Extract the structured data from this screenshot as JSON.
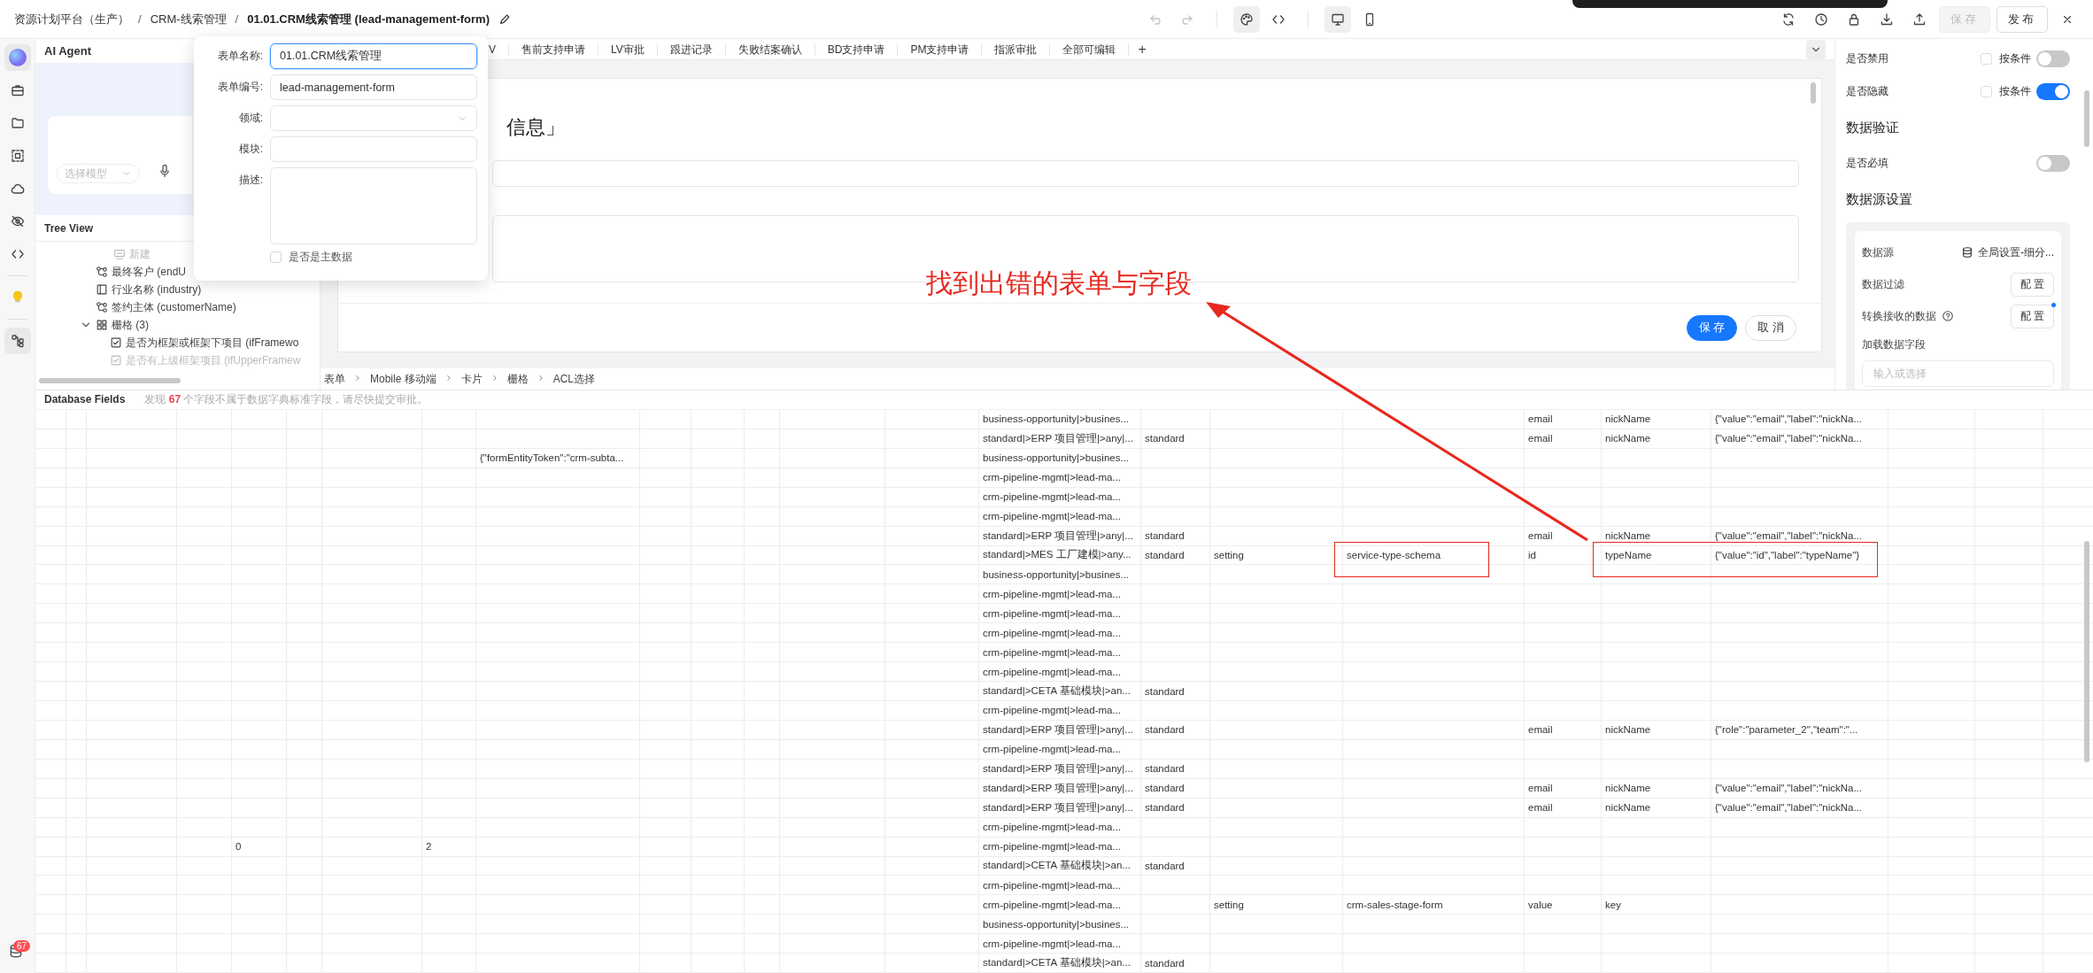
{
  "topbar": {
    "breadcrumb": [
      "资源计划平台（生产）",
      "CRM-线索管理",
      "01.01.CRM线索管理 (lead-management-form)"
    ],
    "separator": "/",
    "history_buttons": [
      {
        "kind": "undo",
        "disabled": true
      },
      {
        "kind": "redo",
        "disabled": true
      }
    ],
    "mode_toggles": [
      {
        "kind": "design",
        "selected": true
      },
      {
        "kind": "code",
        "selected": false
      }
    ],
    "device_toggles": [
      {
        "kind": "desktop",
        "selected": true
      },
      {
        "kind": "mobile",
        "selected": false
      }
    ],
    "actions": [
      {
        "kind": "refresh"
      },
      {
        "kind": "history"
      },
      {
        "kind": "lock"
      },
      {
        "kind": "download"
      },
      {
        "kind": "upload"
      }
    ],
    "save_button": {
      "label": "保存",
      "disabled": true
    },
    "publish_button": {
      "label": "发布"
    }
  },
  "rail": {
    "items": [
      {
        "kind": "agent",
        "selected": true
      },
      {
        "kind": "briefcase",
        "selected": false
      },
      {
        "kind": "folder",
        "selected": false
      },
      {
        "kind": "select",
        "selected": false
      },
      {
        "kind": "cloud",
        "selected": false
      },
      {
        "kind": "hidden",
        "selected": false
      },
      {
        "kind": "code",
        "selected": false
      },
      {
        "kind": "bulb",
        "selected": false
      },
      {
        "kind": "flow",
        "selected": true
      }
    ],
    "badge": "67"
  },
  "agent_panel": {
    "title": "AI Agent",
    "model_select": {
      "placeholder": "选择模型"
    }
  },
  "tree_view": {
    "title": "Tree View",
    "items": [
      {
        "label": "新建",
        "kind": "new",
        "disabled": true
      },
      {
        "label": "最终客户 (endU",
        "kind": "relation",
        "disabled": false
      },
      {
        "label": "行业名称 (industry)",
        "kind": "text",
        "disabled": false
      },
      {
        "label": "签约主体 (customerName)",
        "kind": "relation",
        "disabled": false
      },
      {
        "label": "栅格 (3)",
        "kind": "grid",
        "disabled": false,
        "expanded": true,
        "children": [
          {
            "label": "是否为框架或框架下项目 (ifFramewo",
            "kind": "checkbox",
            "disabled": false
          },
          {
            "label": "是否有上级框架项目 (ifUpperFramew",
            "kind": "checkbox",
            "disabled": true
          }
        ]
      }
    ]
  },
  "form_settings": {
    "fields": [
      {
        "label": "表单名称:",
        "kind": "input",
        "value": "01.01.CRM线索管理",
        "focused": true
      },
      {
        "label": "表单编号:",
        "kind": "input",
        "value": "lead-management-form",
        "focused": false
      },
      {
        "label": "领域:",
        "kind": "select",
        "focused": false
      },
      {
        "label": "模块:",
        "kind": "input",
        "focused": false
      },
      {
        "label": "描述:",
        "kind": "textarea",
        "focused": false
      }
    ],
    "master_data": {
      "label": "是否是主数据",
      "checked": false
    }
  },
  "canvas": {
    "tabs": [
      "V",
      "售前支持申请",
      "LV审批",
      "跟进记录",
      "失败结案确认",
      "BD支持申请",
      "PM支持申请",
      "指派审批",
      "全部可编辑"
    ],
    "add_tab": "+",
    "heading": "信息」",
    "save_button": "保 存",
    "cancel_button": "取 消",
    "path": [
      "表单",
      "Mobile 移动端",
      "卡片",
      "栅格",
      "ACL选择"
    ]
  },
  "properties": {
    "switches": [
      {
        "label": "是否禁用",
        "condition": {
          "label": "按条件",
          "checked": false
        },
        "on": false
      },
      {
        "label": "是否隐藏",
        "condition": {
          "label": "按条件",
          "checked": false
        },
        "on": true
      }
    ],
    "validation": {
      "title": "数据验证",
      "switches": [
        {
          "label": "是否必填",
          "on": false
        }
      ]
    },
    "datasource": {
      "title": "数据源设置",
      "source": {
        "label": "数据源",
        "value": "全局设置-细分..."
      },
      "filter": {
        "label": "数据过滤",
        "button": "配 置"
      },
      "transform": {
        "label": "转换接收的数据",
        "button": "配 置",
        "modified": true
      },
      "load_fields": {
        "label": "加载数据字段",
        "placeholder": "输入或选择"
      }
    }
  },
  "database_fields": {
    "title": "Database Fields",
    "message": "发现 **67** 个字段不属于数据字典标准字段，请尽快提交审批。",
    "rows": [
      {
        "column_15": "business-opportunity|>busines...",
        "column_19": "email",
        "column_20": "nickName",
        "column_21": "{\"value\":\"email\",\"label\":\"nickNa..."
      },
      {
        "column_15": "standard|>ERP 项目管理|>any|...",
        "column_16": "standard",
        "column_19": "email",
        "column_20": "nickName",
        "column_21": "{\"value\":\"email\",\"label\":\"nickNa..."
      },
      {
        "column_9": "{\"formEntityToken\":\"crm-subta...",
        "column_15": "business-opportunity|>busines..."
      },
      {
        "column_15": "crm-pipeline-mgmt|>lead-ma..."
      },
      {
        "column_15": "crm-pipeline-mgmt|>lead-ma..."
      },
      {
        "column_15": "crm-pipeline-mgmt|>lead-ma..."
      },
      {
        "column_15": "standard|>ERP 项目管理|>any|...",
        "column_16": "standard",
        "column_19": "email",
        "column_20": "nickName",
        "column_21": "{\"value\":\"email\",\"label\":\"nickNa..."
      },
      {
        "column_15": "standard|>MES 工厂建模|>any...",
        "column_16": "standard",
        "column_17": "setting",
        "column_18": {
          "text": "service-type-schema",
          "outlined": true
        },
        "column_19": "id",
        "column_20": {
          "text": "typeName",
          "outlined": true
        },
        "column_21": {
          "text": "{\"value\":\"id\",\"label\":\"typeName\"}",
          "outlined": true
        }
      },
      {
        "column_15": "business-opportunity|>busines..."
      },
      {
        "column_15": "crm-pipeline-mgmt|>lead-ma..."
      },
      {
        "column_15": "crm-pipeline-mgmt|>lead-ma..."
      },
      {
        "column_15": "crm-pipeline-mgmt|>lead-ma..."
      },
      {
        "column_15": "crm-pipeline-mgmt|>lead-ma..."
      },
      {
        "column_15": "crm-pipeline-mgmt|>lead-ma..."
      },
      {
        "column_15": "standard|>CETA 基础模块|>an...",
        "column_16": "standard"
      },
      {
        "column_15": "crm-pipeline-mgmt|>lead-ma..."
      },
      {
        "column_15": "standard|>ERP 项目管理|>any|...",
        "column_16": "standard",
        "column_19": "email",
        "column_20": "nickName",
        "column_21": "{\"role\":\"parameter_2\",\"team\":\"..."
      },
      {
        "column_15": "crm-pipeline-mgmt|>lead-ma..."
      },
      {
        "column_15": "standard|>ERP 项目管理|>any|...",
        "column_16": "standard"
      },
      {
        "column_15": "standard|>ERP 项目管理|>any|...",
        "column_16": "standard",
        "column_19": "email",
        "column_20": "nickName",
        "column_21": "{\"value\":\"email\",\"label\":\"nickNa..."
      },
      {
        "column_15": "standard|>ERP 项目管理|>any|...",
        "column_16": "standard",
        "column_19": "email",
        "column_20": "nickName",
        "column_21": "{\"value\":\"email\",\"label\":\"nickNa..."
      },
      {
        "column_15": "crm-pipeline-mgmt|>lead-ma..."
      },
      {
        "column_5": "0",
        "column_8": "2",
        "column_15": "crm-pipeline-mgmt|>lead-ma..."
      },
      {
        "column_15": "standard|>CETA 基础模块|>an...",
        "column_16": "standard"
      },
      {
        "column_15": "crm-pipeline-mgmt|>lead-ma..."
      },
      {
        "column_15": "crm-pipeline-mgmt|>lead-ma...",
        "column_17": "setting",
        "column_18": "crm-sales-stage-form",
        "column_19": "value",
        "column_20": "key"
      },
      {
        "column_15": "business-opportunity|>busines..."
      },
      {
        "column_15": "crm-pipeline-mgmt|>lead-ma..."
      },
      {
        "column_15": "standard|>CETA 基础模块|>an...",
        "column_16": "standard"
      }
    ]
  },
  "annotation": {
    "text": "找到出错的表单与字段"
  }
}
